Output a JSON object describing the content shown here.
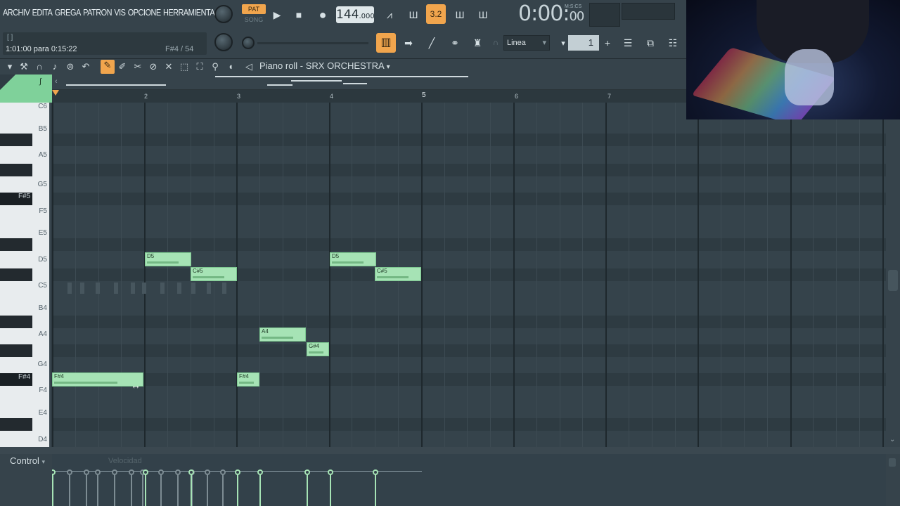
{
  "menu": [
    "ARCHIV",
    "EDITA",
    "GREGA",
    "PATRON",
    "VIS",
    "OPCIONE",
    "HERRAMIENTA"
  ],
  "hint": {
    "brackets": "[ ]",
    "text": "1:01:00 para 0:15:22",
    "note": "F#4 / 54"
  },
  "transport": {
    "pat_label": "PAT",
    "song_label": "SONG",
    "tempo_int": "144",
    "tempo_frac": ".000",
    "time_main": "0:00:",
    "time_cs": "00",
    "time_format": "M:S:CS",
    "pattern_step": "3.2"
  },
  "snap": {
    "value": "Linea",
    "step": "1"
  },
  "piano_roll": {
    "title": "Piano roll - SRX ORCHESTRA"
  },
  "ruler": {
    "bars": [
      "2",
      "3",
      "4",
      "5",
      "6",
      "7"
    ]
  },
  "keys": {
    "white_labels": [
      {
        "label": "C6"
      },
      {
        "label": "B5"
      },
      {
        "label": "A5"
      },
      {
        "label": "G5"
      },
      {
        "label": "F5"
      },
      {
        "label": "E5"
      },
      {
        "label": "D5"
      },
      {
        "label": "C5"
      },
      {
        "label": "B4"
      },
      {
        "label": "A4"
      },
      {
        "label": "G4"
      },
      {
        "label": "F4"
      },
      {
        "label": "E4"
      },
      {
        "label": "D4"
      }
    ],
    "highlighted": [
      "F#5",
      "F#4"
    ]
  },
  "notes": [
    {
      "label": "F#4"
    },
    {
      "label": "D5"
    },
    {
      "label": "C#5"
    },
    {
      "label": "F#4"
    },
    {
      "label": "A4"
    },
    {
      "label": "G#4"
    },
    {
      "label": "D5"
    },
    {
      "label": "C#5"
    }
  ],
  "control": {
    "label": "Control",
    "placeholder": "Velocidad"
  },
  "colors": {
    "note_fill": "#a6e3b5",
    "accent": "#f1a54d",
    "background": "#35434b"
  }
}
